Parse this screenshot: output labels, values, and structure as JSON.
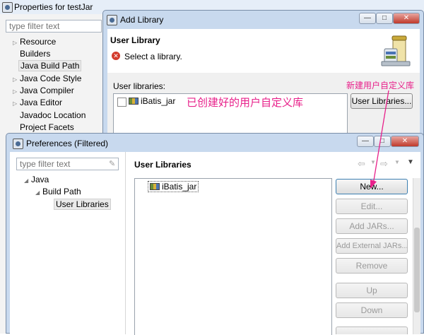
{
  "properties_window": {
    "title": "Properties for testJar",
    "filter_placeholder": "type filter text",
    "tree": [
      {
        "label": "Resource",
        "expandable": true
      },
      {
        "label": "Builders",
        "expandable": false
      },
      {
        "label": "Java Build Path",
        "expandable": false,
        "selected": true
      },
      {
        "label": "Java Code Style",
        "expandable": true
      },
      {
        "label": "Java Compiler",
        "expandable": true
      },
      {
        "label": "Java Editor",
        "expandable": true
      },
      {
        "label": "Javadoc Location",
        "expandable": false
      },
      {
        "label": "Project Facets",
        "expandable": false
      }
    ]
  },
  "add_library_window": {
    "title": "Add Library",
    "banner_title": "User Library",
    "banner_message": "Select a library.",
    "user_libraries_label": "User libraries:",
    "library_item": "iBatis_jar",
    "user_libraries_button": "User Libraries...",
    "minimize": "—",
    "maximize": "□",
    "close": "✕"
  },
  "preferences_window": {
    "title": "Preferences (Filtered)",
    "filter_placeholder": "type filter text",
    "tree": [
      {
        "label": "Java",
        "level": 0
      },
      {
        "label": "Build Path",
        "level": 1
      },
      {
        "label": "User Libraries",
        "level": 2,
        "selected": true
      }
    ],
    "section_title": "User Libraries",
    "library_item": "iBatis_jar",
    "buttons": {
      "new": "New...",
      "edit": "Edit...",
      "add_jars": "Add JARs...",
      "add_external_jars": "Add External JARs...",
      "remove": "Remove",
      "up": "Up",
      "down": "Down"
    },
    "minimize": "—",
    "maximize": "□",
    "close": "✕"
  },
  "annotations": {
    "created_library": "已创建好的用户自定义库",
    "new_library": "新建用户自定义库"
  },
  "colors": {
    "annotation": "#e8208a",
    "titlebar": "#c8d9ee"
  }
}
